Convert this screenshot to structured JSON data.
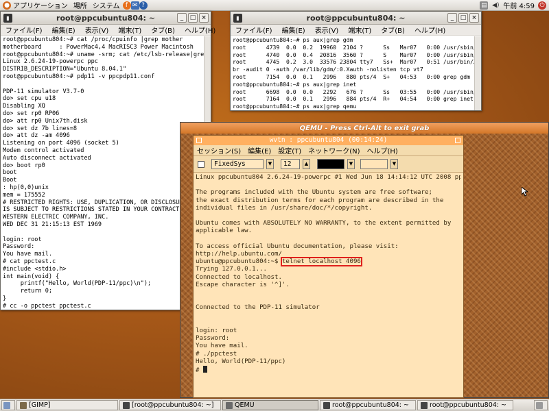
{
  "topbar": {
    "menus": [
      "アプリケーション",
      "場所",
      "システム"
    ],
    "clock": "午前 4:59"
  },
  "term1": {
    "title": "root@ppcubuntu804: ~",
    "menu": [
      "ファイル(F)",
      "編集(E)",
      "表示(V)",
      "端末(T)",
      "タブ(B)",
      "ヘルプ(H)"
    ],
    "lines": [
      "root@ppcubuntu804:~# cat /proc/cpuinfo |grep mother",
      "motherboard     : PowerMac4,4 MacRISC3 Power Macintosh",
      "root@ppcubuntu804:~# uname -srm; cat /etc/lsb-release|grep DESC",
      "Linux 2.6.24-19-powerpc ppc",
      "DISTRIB_DESCRIPTION=\"Ubuntu 8.04.1\"",
      "root@ppcubuntu804:~# pdp11 -v ppcpdp11.conf",
      "",
      "PDP-11 simulator V3.7-0",
      "do> set cpu u18",
      "Disabling XQ",
      "do> set rp0 RP06",
      "do> att rp0 Unix7th.disk",
      "do> set dz 7b lines=8",
      "do> att dz -am 4096",
      "Listening on port 4096 (socket 5)",
      "Modem control activated",
      "Auto disconnect activated",
      "do> boot rp0",
      "boot",
      "Boot",
      ": hp(0,0)unix",
      "mem = 175552",
      "# RESTRICTED RIGHTS: USE, DUPLICATION, OR DISCLOSURE",
      "IS SUBJECT TO RESTRICTIONS STATED IN YOUR CONTRACT WITH",
      "WESTERN ELECTRIC COMPANY, INC.",
      "WED DEC 31 21:15:13 EST 1969",
      "",
      "login: root",
      "Password:",
      "You have mail.",
      "# cat ppctest.c",
      "#include <stdio.h>",
      "int main(void) {",
      "     printf(\"Hello, World(PDP-11/ppc)\\n\");",
      "     return 0;",
      "}",
      "# cc -o ppctest ppctest.c"
    ],
    "prompt": "# "
  },
  "term2": {
    "title": "root@ppcubuntu804: ~",
    "menu": [
      "ファイル(F)",
      "編集(E)",
      "表示(V)",
      "端末(T)",
      "タブ(B)",
      "ヘルプ(H)"
    ],
    "lines": [
      "root@ppcubuntu804:~# ps aux|grep gdm",
      "root      4739  0.0  0.2  19960  2104 ?      Ss   Mar07   0:00 /usr/sbin/gdm",
      "root      4740  0.0  0.4  20816  3560 ?      S    Mar07   0:00 /usr/sbin/gdm",
      "root      4745  0.2  3.0  33576 23804 tty7   Ss+  Mar07   0:51 /usr/bin/X :0 -",
      "br -audit 0 -auth /var/lib/gdm/:0.Xauth -nolisten tcp vt7",
      "root      7154  0.0  0.1   2996   880 pts/4  S+   04:53   0:00 grep gdm",
      "root@ppcubuntu804:~# ps aux|grep inet",
      "root      6698  0.0  0.0   2292   676 ?      Ss   03:55   0:00 /usr/sbin/inetd",
      "root      7164  0.0  0.1   2996   884 pts/4  R+   04:54   0:00 grep inet",
      "root@ppcubuntu804:~# ps aux|grep qemu",
      "root      6988 87.0  3.2  85292 25152 pts/1  R    04:30  21:01 qemu -m 48 -hda"
    ]
  },
  "qemu": {
    "title": "QEMU - Press Ctrl-Alt to exit grab",
    "wvtn": {
      "title": "wvtn : ppcubuntu804 (00:14:24)",
      "menu": [
        "セッション(S)",
        "編集(E)",
        "設定(T)",
        "ネットワーク(N)",
        "ヘルプ(H)"
      ],
      "font": "FixedSys",
      "size": "12",
      "colors": {
        "fg": "#000000",
        "bg": "#ffe4b8"
      },
      "before": [
        "Linux ppcubuntu804 2.6.24-19-powerpc #1 Wed Jun 18 14:14:12 UTC 2008 ppc",
        "",
        "The programs included with the Ubuntu system are free software;",
        "the exact distribution terms for each program are described in the",
        "individual files in /usr/share/doc/*/copyright.",
        "",
        "Ubuntu comes with ABSOLUTELY NO WARRANTY, to the extent permitted by",
        "applicable law.",
        "",
        "To access official Ubuntu documentation, please visit:",
        "http://help.ubuntu.com/"
      ],
      "prompt": "ubuntu@ppcubuntu804:~$ ",
      "command": "telnet localhost 4096",
      "after": [
        "Trying 127.0.0.1...",
        "Connected to localhost.",
        "Escape character is '^]'.",
        "",
        "",
        "Connected to the PDP-11 simulator",
        "",
        "",
        "login: root",
        "Password:",
        "You have mail.",
        "# ./ppctest",
        "Hello, World(PDP-11/ppc)"
      ],
      "final_prompt": "# "
    }
  },
  "taskbar": {
    "items": [
      "[GIMP]",
      "[root@ppcubuntu804: ~]",
      "QEMU",
      "root@ppcubuntu804: ~",
      "root@ppcubuntu804: ~"
    ]
  }
}
